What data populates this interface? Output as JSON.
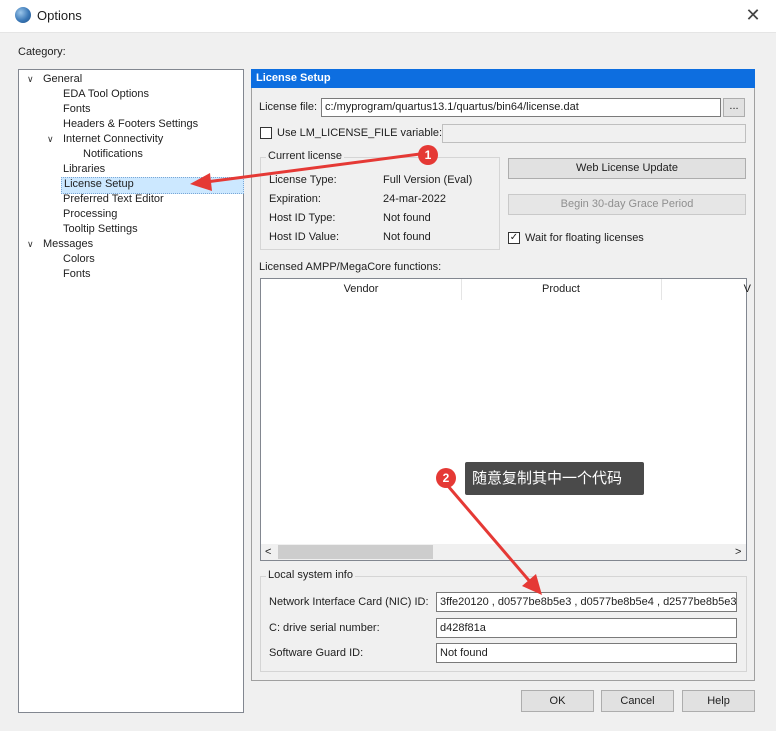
{
  "window": {
    "title": "Options",
    "close_glyph": "✕"
  },
  "category_label": "Category:",
  "tree": [
    {
      "label": "General",
      "level": 0,
      "expanded": true
    },
    {
      "label": "EDA Tool Options",
      "level": 1
    },
    {
      "label": "Fonts",
      "level": 1
    },
    {
      "label": "Headers & Footers Settings",
      "level": 1
    },
    {
      "label": "Internet Connectivity",
      "level": 1,
      "expanded": true
    },
    {
      "label": "Notifications",
      "level": 2
    },
    {
      "label": "Libraries",
      "level": 1
    },
    {
      "label": "License Setup",
      "level": 1,
      "selected": true
    },
    {
      "label": "Preferred Text Editor",
      "level": 1
    },
    {
      "label": "Processing",
      "level": 1
    },
    {
      "label": "Tooltip Settings",
      "level": 1
    },
    {
      "label": "Messages",
      "level": 0,
      "expanded": true
    },
    {
      "label": "Colors",
      "level": 1
    },
    {
      "label": "Fonts",
      "level": 1
    }
  ],
  "panel": {
    "header": "License Setup",
    "license_file_label": "License file:",
    "license_file_value": "c:/myprogram/quartus13.1/quartus/bin64/license.dat",
    "browse_label": "...",
    "use_lm_label": "Use LM_LICENSE_FILE variable:",
    "use_lm_value": "",
    "current_license": {
      "title": "Current license",
      "rows": [
        {
          "label": "License Type:",
          "value": "Full Version (Eval)"
        },
        {
          "label": "Expiration:",
          "value": "24-mar-2022"
        },
        {
          "label": "Host ID Type:",
          "value": "Not found"
        },
        {
          "label": "Host ID Value:",
          "value": "Not found"
        }
      ]
    },
    "web_license_update": "Web License Update",
    "grace_period": "Begin 30-day Grace Period",
    "wait_floating": {
      "label": "Wait for floating licenses",
      "checked": true
    },
    "ampp_label": "Licensed AMPP/MegaCore functions:",
    "table_columns": [
      "Vendor",
      "Product",
      "V"
    ],
    "scroll_left": "<",
    "scroll_right": ">",
    "local_info": {
      "title": "Local system info",
      "nic_label": "Network Interface Card (NIC) ID:",
      "nic_value": "3ffe20120 , d0577be8b5e3 , d0577be8b5e4 , d2577be8b5e3",
      "drive_label": "C: drive serial number:",
      "drive_value": "d428f81a",
      "guard_label": "Software Guard ID:",
      "guard_value": "Not found"
    }
  },
  "buttons": {
    "ok": "OK",
    "cancel": "Cancel",
    "help": "Help"
  },
  "annotations": {
    "badge1": "1",
    "badge2": "2",
    "tooltip": "随意复制其中一个代码",
    "color": "#e53935"
  }
}
